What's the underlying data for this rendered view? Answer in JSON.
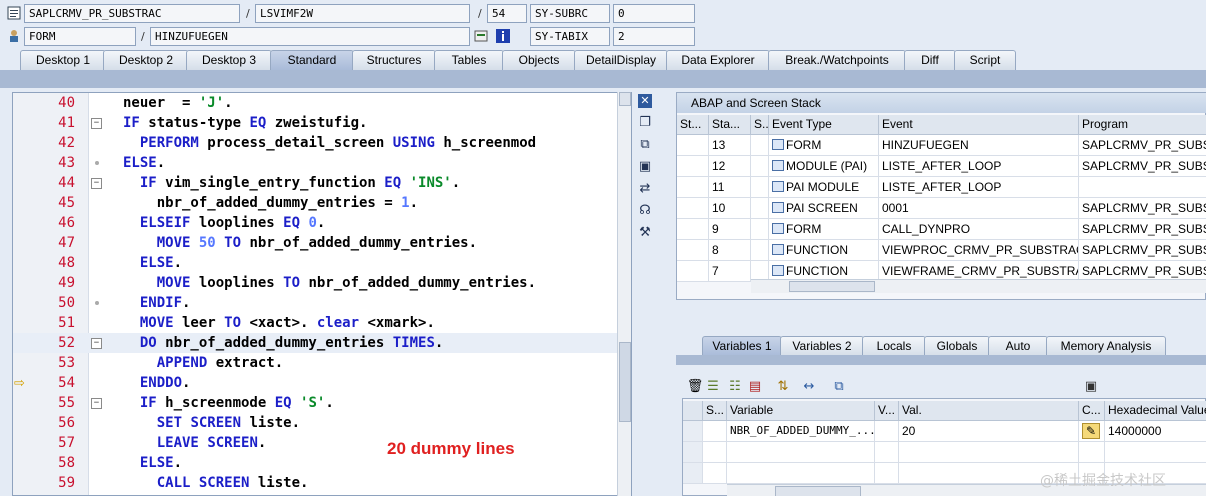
{
  "header": {
    "row1": {
      "program": "SAPLCRMV_PR_SUBSTRAC",
      "include": "LSVIMF2W",
      "line": "54",
      "sysvar_label": "SY-SUBRC",
      "sysvar_value": "0"
    },
    "row2": {
      "type": "FORM",
      "event": "HINZUFUEGEN",
      "sysvar_label": "SY-TABIX",
      "sysvar_value": "2"
    },
    "separator": "/"
  },
  "tabs": [
    "Desktop 1",
    "Desktop 2",
    "Desktop 3",
    "Standard",
    "Structures",
    "Tables",
    "Objects",
    "DetailDisplay",
    "Data Explorer",
    "Break./Watchpoints",
    "Diff",
    "Script"
  ],
  "active_tab": "Standard",
  "code_lines": [
    {
      "n": "40",
      "fold": "",
      "text": "  neuer  = 'J'."
    },
    {
      "n": "41",
      "fold": "-",
      "text": "  IF status-type EQ zweistufig."
    },
    {
      "n": "42",
      "fold": "",
      "text": "    PERFORM process_detail_screen USING h_screenmod"
    },
    {
      "n": "43",
      "fold": "",
      "text": "  ELSE."
    },
    {
      "n": "44",
      "fold": "-",
      "text": "    IF vim_single_entry_function EQ 'INS'."
    },
    {
      "n": "45",
      "fold": "",
      "text": "      nbr_of_added_dummy_entries = 1."
    },
    {
      "n": "46",
      "fold": "",
      "text": "    ELSEIF looplines EQ 0."
    },
    {
      "n": "47",
      "fold": "",
      "text": "      MOVE 50 TO nbr_of_added_dummy_entries."
    },
    {
      "n": "48",
      "fold": "",
      "text": "    ELSE."
    },
    {
      "n": "49",
      "fold": "",
      "text": "      MOVE looplines TO nbr_of_added_dummy_entries."
    },
    {
      "n": "50",
      "fold": "",
      "text": "    ENDIF."
    },
    {
      "n": "51",
      "fold": "",
      "text": "    MOVE leer TO <xact>. clear <xmark>."
    },
    {
      "n": "52",
      "fold": "-",
      "text": "    DO nbr_of_added_dummy_entries TIMES."
    },
    {
      "n": "53",
      "fold": "",
      "text": "      APPEND extract."
    },
    {
      "n": "54",
      "fold": "",
      "text": "    ENDDO."
    },
    {
      "n": "55",
      "fold": "-",
      "text": "    IF h_screenmode EQ 'S'."
    },
    {
      "n": "56",
      "fold": "",
      "text": "      SET SCREEN liste."
    },
    {
      "n": "57",
      "fold": "",
      "text": "      LEAVE SCREEN."
    },
    {
      "n": "58",
      "fold": "",
      "text": "    ELSE."
    },
    {
      "n": "59",
      "fold": "",
      "text": "      CALL SCREEN liste."
    }
  ],
  "annotation": "20 dummy lines",
  "stack": {
    "title": "ABAP and Screen Stack",
    "columns": [
      "St...",
      "Sta...",
      "S...",
      "Event Type",
      "Event",
      "Program"
    ],
    "rows": [
      {
        "no": "13",
        "type": "FORM",
        "event": "HINZUFUEGEN",
        "program": "SAPLCRMV_PR_SUBSTR",
        "current": true
      },
      {
        "no": "12",
        "type": "MODULE (PAI)",
        "event": "LISTE_AFTER_LOOP",
        "program": "SAPLCRMV_PR_SUBSTR",
        "current": false
      },
      {
        "no": "11",
        "type": "PAI MODULE",
        "event": "LISTE_AFTER_LOOP",
        "program": "",
        "current": false
      },
      {
        "no": "10",
        "type": "PAI SCREEN",
        "event": "0001",
        "program": "SAPLCRMV_PR_SUBSTR",
        "current": false
      },
      {
        "no": "9",
        "type": "FORM",
        "event": "CALL_DYNPRO",
        "program": "SAPLCRMV_PR_SUBSTR",
        "current": false
      },
      {
        "no": "8",
        "type": "FUNCTION",
        "event": "VIEWPROC_CRMV_PR_SUBSTRAC",
        "program": "SAPLCRMV_PR_SUBSTR",
        "current": false
      },
      {
        "no": "7",
        "type": "FUNCTION",
        "event": "VIEWFRAME_CRMV_PR_SUBSTRAC",
        "program": "SAPLCRMV_PR_SUBSTR",
        "current": false
      }
    ]
  },
  "var_tabs": [
    "Variables 1",
    "Variables 2",
    "Locals",
    "Globals",
    "Auto",
    "Memory Analysis"
  ],
  "variables": {
    "columns": [
      "S...",
      "Variable",
      "V...",
      "Val.",
      "C...",
      "Hexadecimal Value"
    ],
    "rows": [
      {
        "name": "NBR_OF_ADDED_DUMMY_...",
        "value": "20",
        "hex": "14000000"
      }
    ]
  },
  "watermark": "@稀土掘金技术社区"
}
